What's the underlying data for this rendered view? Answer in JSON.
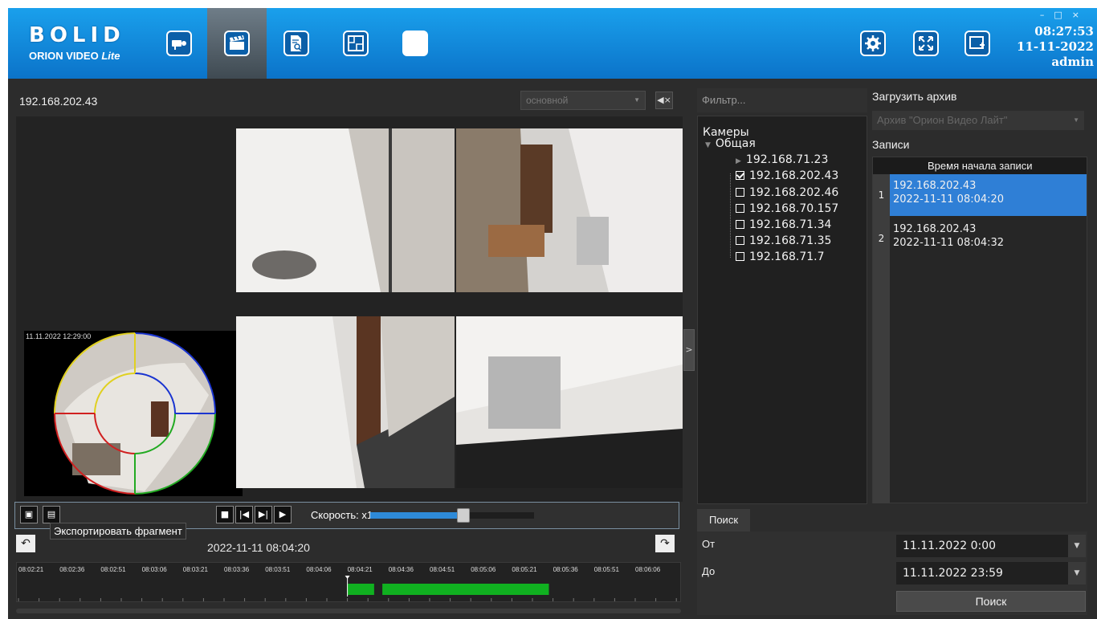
{
  "header": {
    "logo_main": "BOLID",
    "logo_sub": "ORION VIDEO",
    "logo_sub_italic": "Lite",
    "nav": [
      {
        "name": "cameras",
        "icon": "camera-icon",
        "active": false
      },
      {
        "name": "archive",
        "icon": "clapperboard-icon",
        "active": true
      },
      {
        "name": "journal",
        "icon": "document-search-icon",
        "active": false
      },
      {
        "name": "plan",
        "icon": "floor-plan-icon",
        "active": false
      },
      {
        "name": "blank",
        "icon": "window-icon",
        "active": false
      }
    ],
    "right_buttons": [
      "gear-icon",
      "fullscreen-icon",
      "add-window-icon"
    ],
    "time": "08:27:53",
    "date": "11-11-2022",
    "user": "admin",
    "window_controls": [
      "–",
      "□",
      "×"
    ],
    "accent": "#0b73c9"
  },
  "player": {
    "camera_title": "192.168.202.43",
    "stream_select": "основной",
    "fisheye_stamp": "11.11.2022 12:29:00",
    "speed_label": "Скорость: x1",
    "speed_level": 0.57,
    "tooltip": "Экспортировать фрагмент",
    "current_time": "2022-11-11 08:04:20",
    "collapse_label": ">"
  },
  "timeline": {
    "ticks": [
      "08:02:21",
      "08:02:36",
      "08:02:51",
      "08:03:06",
      "08:03:21",
      "08:03:36",
      "08:03:51",
      "08:04:06",
      "08:04:21",
      "08:04:36",
      "08:04:51",
      "08:05:06",
      "08:05:21",
      "08:05:36",
      "08:05:51",
      "08:06:06"
    ],
    "cursor_index": 8,
    "segments": [
      {
        "from": 8.0,
        "to": 8.65
      },
      {
        "from": 8.85,
        "to": 12.9
      }
    ],
    "segment_color": "#10b020"
  },
  "cameras": {
    "filter_placeholder": "Фильтр...",
    "tree_title": "Камеры",
    "group": "Общая",
    "items": [
      {
        "label": "192.168.71.23",
        "type": "folder",
        "checked": false
      },
      {
        "label": "192.168.202.43",
        "type": "check",
        "checked": true
      },
      {
        "label": "192.168.202.46",
        "type": "check",
        "checked": false
      },
      {
        "label": "192.168.70.157",
        "type": "check",
        "checked": false
      },
      {
        "label": "192.168.71.34",
        "type": "check",
        "checked": false
      },
      {
        "label": "192.168.71.35",
        "type": "check",
        "checked": false
      },
      {
        "label": "192.168.71.7",
        "type": "check",
        "checked": false
      }
    ]
  },
  "archive": {
    "load_label": "Загрузить архив",
    "archive_select": "Архив \"Орион Видео Лайт\"",
    "records_label": "Записи",
    "column_header": "Время начала записи",
    "records": [
      {
        "num": "1",
        "camera": "192.168.202.43",
        "start": "2022-11-11 08:04:20",
        "selected": true
      },
      {
        "num": "2",
        "camera": "192.168.202.43",
        "start": "2022-11-11 08:04:32",
        "selected": false
      }
    ]
  },
  "search": {
    "tab": "Поиск",
    "from_label": "От",
    "to_label": "До",
    "from_value": "11.11.2022 0:00",
    "to_value": "11.11.2022 23:59",
    "button": "Поиск"
  }
}
